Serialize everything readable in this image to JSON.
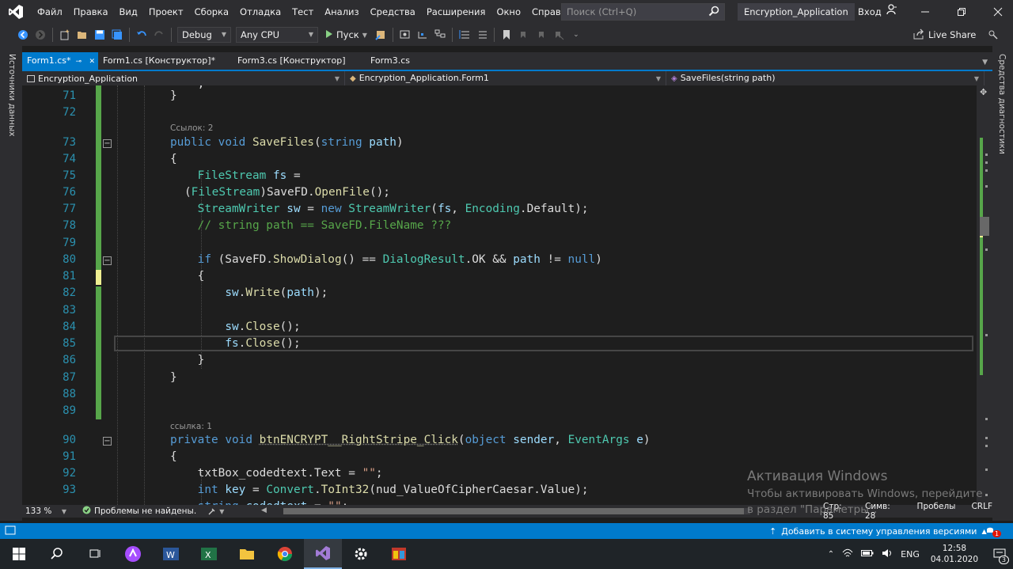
{
  "menubar": {
    "items": [
      "Файл",
      "Правка",
      "Вид",
      "Проект",
      "Сборка",
      "Отладка",
      "Тест",
      "Анализ",
      "Средства",
      "Расширения",
      "Окно",
      "Справка"
    ],
    "search_placeholder": "Поиск (Ctrl+Q)",
    "solution_name": "Encryption_Application",
    "signin_label": "Вход"
  },
  "toolbar": {
    "configuration": "Debug",
    "platform": "Any CPU",
    "run_label": "Пуск",
    "liveshare_label": "Live Share"
  },
  "side": {
    "left_label": "Источники данных",
    "right_label": "Средства диагностики"
  },
  "tabs": [
    {
      "label": "Form1.cs*",
      "active": true
    },
    {
      "label": "Form1.cs [Конструктор]*",
      "active": false
    },
    {
      "label": "Form3.cs [Конструктор]",
      "active": false
    },
    {
      "label": "Form3.cs",
      "active": false
    }
  ],
  "navbar": {
    "project": "Encryption_Application",
    "class": "Encryption_Application.Form1",
    "member": "SaveFiles(string path)"
  },
  "editor": {
    "refs_2": "Ссылок: 2",
    "refs_1": "ссылка: 1",
    "line_numbers": [
      "71",
      "72",
      "73",
      "74",
      "75",
      "76",
      "77",
      "78",
      "79",
      "80",
      "81",
      "82",
      "83",
      "84",
      "85",
      "86",
      "87",
      "88",
      "89",
      "90",
      "91",
      "92",
      "93"
    ]
  },
  "status_row": {
    "zoom": "133 %",
    "issues": "Проблемы не найдены.",
    "line": "Стр: 85",
    "col": "Симв: 28",
    "indent": "Пробелы",
    "eol": "CRLF"
  },
  "watermark": {
    "title": "Активация Windows",
    "text": "Чтобы активировать Windows, перейдите в раздел \"Параметры\"."
  },
  "statusbar": {
    "source_control": "Добавить в систему управления версиями",
    "notifications": "1"
  },
  "taskbar": {
    "language": "ENG",
    "time": "12:58",
    "date": "04.01.2020",
    "notif_count": "3"
  },
  "colors": {
    "accent": "#007acc",
    "editor_bg": "#1e1e1e",
    "chrome_bg": "#2d2d30",
    "keyword": "#569cd6",
    "type": "#4ec9b0",
    "method": "#dcdcaa",
    "comment": "#57a64a",
    "string": "#d69d85",
    "line_number": "#2b91af"
  }
}
